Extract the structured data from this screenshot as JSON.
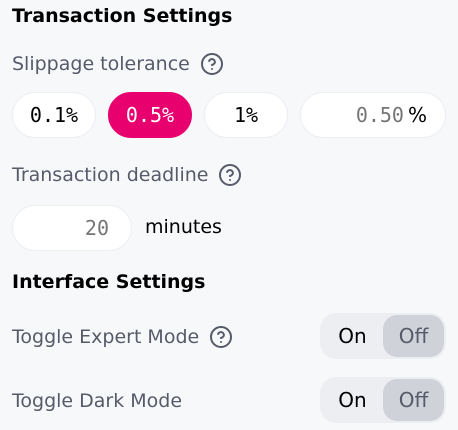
{
  "transaction_settings": {
    "title": "Transaction Settings",
    "slippage_label": "Slippage tolerance",
    "slippage_options": [
      "0.1%",
      "0.5%",
      "1%"
    ],
    "slippage_selected": "0.5%",
    "slippage_custom_placeholder": "0.50",
    "slippage_unit": "%",
    "deadline_label": "Transaction deadline",
    "deadline_placeholder": "20",
    "deadline_unit": "minutes"
  },
  "interface_settings": {
    "title": "Interface Settings",
    "expert_mode": {
      "label": "Toggle Expert Mode",
      "on_label": "On",
      "off_label": "Off",
      "state": "Off"
    },
    "dark_mode": {
      "label": "Toggle Dark Mode",
      "on_label": "On",
      "off_label": "Off",
      "state": "Off"
    }
  },
  "icons": {
    "help": "question-circle-icon"
  },
  "colors": {
    "accent": "#e8006f",
    "label": "#565a69",
    "background": "#f7f8fa"
  }
}
